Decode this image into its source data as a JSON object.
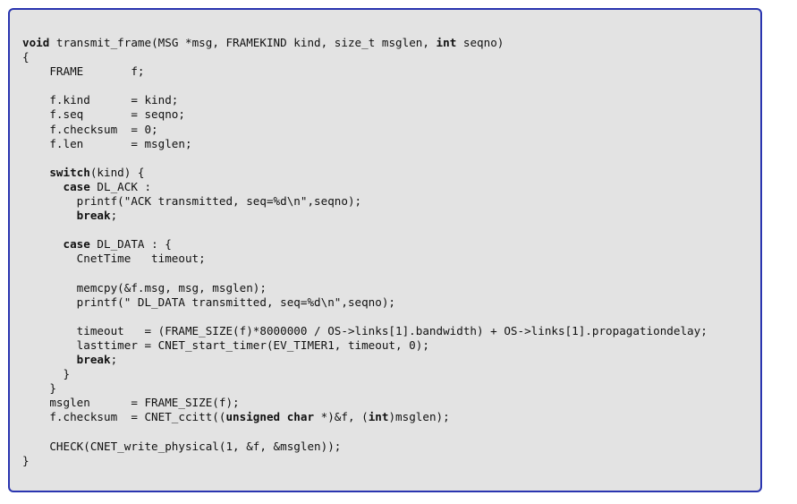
{
  "code": {
    "lines": [
      [
        {
          "t": "void",
          "kw": true
        },
        {
          "t": " transmit_frame(MSG *msg, FRAMEKIND kind, size_t msglen, "
        },
        {
          "t": "int",
          "kw": true
        },
        {
          "t": " seqno)"
        }
      ],
      [
        {
          "t": "{"
        }
      ],
      [
        {
          "t": "    FRAME       f;"
        }
      ],
      [],
      [
        {
          "t": "    f.kind      = kind;"
        }
      ],
      [
        {
          "t": "    f.seq       = seqno;"
        }
      ],
      [
        {
          "t": "    f.checksum  = 0;"
        }
      ],
      [
        {
          "t": "    f.len       = msglen;"
        }
      ],
      [],
      [
        {
          "t": "    "
        },
        {
          "t": "switch",
          "kw": true
        },
        {
          "t": "(kind) {"
        }
      ],
      [
        {
          "t": "      "
        },
        {
          "t": "case",
          "kw": true
        },
        {
          "t": " DL_ACK :"
        }
      ],
      [
        {
          "t": "        printf(\"ACK transmitted, seq=%d\\n\",seqno);"
        }
      ],
      [
        {
          "t": "        "
        },
        {
          "t": "break",
          "kw": true
        },
        {
          "t": ";"
        }
      ],
      [],
      [
        {
          "t": "      "
        },
        {
          "t": "case",
          "kw": true
        },
        {
          "t": " DL_DATA : {"
        }
      ],
      [
        {
          "t": "        CnetTime   timeout;"
        }
      ],
      [],
      [
        {
          "t": "        memcpy(&f.msg, msg, msglen);"
        }
      ],
      [
        {
          "t": "        printf(\" DL_DATA transmitted, seq=%d\\n\",seqno);"
        }
      ],
      [],
      [
        {
          "t": "        timeout   = (FRAME_SIZE(f)*8000000 / OS->links[1].bandwidth) + OS->links[1].propagationdelay;"
        }
      ],
      [
        {
          "t": "        lasttimer = CNET_start_timer(EV_TIMER1, timeout, 0);"
        }
      ],
      [
        {
          "t": "        "
        },
        {
          "t": "break",
          "kw": true
        },
        {
          "t": ";"
        }
      ],
      [
        {
          "t": "      }"
        }
      ],
      [
        {
          "t": "    }"
        }
      ],
      [
        {
          "t": "    msglen      = FRAME_SIZE(f);"
        }
      ],
      [
        {
          "t": "    f.checksum  = CNET_ccitt(("
        },
        {
          "t": "unsigned char",
          "kw": true
        },
        {
          "t": " *)&f, ("
        },
        {
          "t": "int",
          "kw": true
        },
        {
          "t": ")msglen);"
        }
      ],
      [],
      [
        {
          "t": "    CHECK(CNET_write_physical(1, &f, &msglen));"
        }
      ],
      [
        {
          "t": "}"
        }
      ]
    ]
  }
}
